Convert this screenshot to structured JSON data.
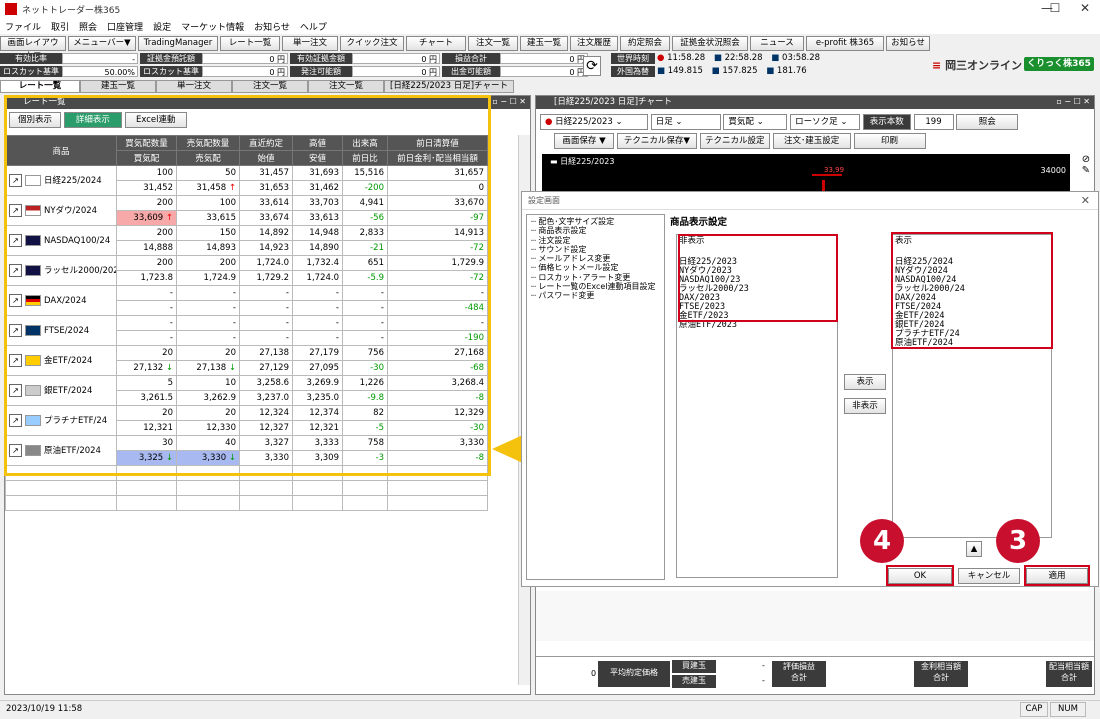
{
  "window": {
    "title": "ネットトレーダー株365",
    "min": "—",
    "max": "☐",
    "close": "✕"
  },
  "menu": [
    "ファイル",
    "取引",
    "照会",
    "口座管理",
    "設定",
    "マーケット情報",
    "お知らせ",
    "ヘルプ"
  ],
  "toolbar": [
    "画面レイアウト▼",
    "メニューバー▼",
    "TradingManager",
    "レート一覧",
    "単一注文",
    "クイック注文",
    "チャート",
    "注文一覧",
    "建玉一覧",
    "注文履歴",
    "約定照会",
    "証拠金状況照会",
    "ニュース",
    "e-profit 株365",
    "お知らせ"
  ],
  "info": {
    "row1": [
      {
        "label": "有効比率",
        "value": "-"
      },
      {
        "label": "証拠金預託額",
        "value": "0 円"
      },
      {
        "label": "有効証拠金額",
        "value": "0 円"
      },
      {
        "label": "損益合計",
        "value": "0 円"
      }
    ],
    "row2": [
      {
        "label": "ロスカット基準",
        "value": "50.00%"
      },
      {
        "label": "ロスカット基準額",
        "value": "0 円"
      },
      {
        "label": "発注可能額",
        "value": "0 円"
      },
      {
        "label": "出金可能額",
        "value": "0 円"
      }
    ],
    "world_time_label": "世界時刻",
    "fx_label": "外国為替",
    "times": [
      "11:58.28",
      "22:58.28",
      "03:58.28"
    ],
    "fx": [
      "149.815",
      "157.825",
      "181.76"
    ]
  },
  "brand": {
    "name": "岡三オンライン",
    "badge": "くりっく株365"
  },
  "tabs": [
    "レート一覧",
    "建玉一覧",
    "単一注文",
    "注文一覧",
    "注文一覧",
    "[日経225/2023 日足]チャート"
  ],
  "rate_panel": {
    "title": "レート一覧",
    "buttons": [
      "個別表示",
      "詳細表示",
      "Excel連動"
    ],
    "headers1": [
      "商品",
      "買気配数量",
      "売気配数量",
      "直近約定",
      "高値",
      "出来高",
      "前日清算値"
    ],
    "headers2": [
      "買気配",
      "売気配",
      "始値",
      "安値",
      "前日比",
      "前日金利･配当相当額"
    ],
    "rows": [
      {
        "name": "日経225/2024",
        "flag": "jp",
        "r1": [
          "100",
          "50",
          "31,457",
          "31,693",
          "15,516",
          "31,657"
        ],
        "r2": [
          "31,452",
          "31,458 ↑",
          "31,653",
          "31,462",
          "-200",
          "0"
        ]
      },
      {
        "name": "NYダウ/2024",
        "flag": "us",
        "r1": [
          "200",
          "100",
          "33,614",
          "33,703",
          "4,941",
          "33,670"
        ],
        "r2": [
          "33,609 ↑",
          "33,615",
          "33,674",
          "33,613",
          "-56",
          "-97"
        ]
      },
      {
        "name": "NASDAQ100/24",
        "flag": "us100",
        "r1": [
          "200",
          "150",
          "14,892",
          "14,948",
          "2,833",
          "14,913"
        ],
        "r2": [
          "14,888",
          "14,893",
          "14,923",
          "14,890",
          "-21",
          "-72"
        ]
      },
      {
        "name": "ラッセル2000/2024",
        "flag": "us2000",
        "r1": [
          "200",
          "200",
          "1,724.0",
          "1,732.4",
          "651",
          "1,729.9"
        ],
        "r2": [
          "1,723.8",
          "1,724.9",
          "1,729.2",
          "1,724.0",
          "-5.9",
          "-72"
        ]
      },
      {
        "name": "DAX/2024",
        "flag": "de",
        "r1": [
          "-",
          "-",
          "-",
          "-",
          "-",
          "-"
        ],
        "r2": [
          "-",
          "-",
          "-",
          "-",
          "-",
          "-484"
        ]
      },
      {
        "name": "FTSE/2024",
        "flag": "uk",
        "r1": [
          "-",
          "-",
          "-",
          "-",
          "-",
          "-"
        ],
        "r2": [
          "-",
          "-",
          "-",
          "-",
          "-",
          "-190"
        ]
      },
      {
        "name": "金ETF/2024",
        "flag": "gold",
        "r1": [
          "20",
          "20",
          "27,138",
          "27,179",
          "756",
          "27,168"
        ],
        "r2": [
          "27,132 ↓",
          "27,138 ↓",
          "27,129",
          "27,095",
          "-30",
          "-68"
        ]
      },
      {
        "name": "銀ETF/2024",
        "flag": "silver",
        "r1": [
          "5",
          "10",
          "3,258.6",
          "3,269.9",
          "1,226",
          "3,268.4"
        ],
        "r2": [
          "3,261.5",
          "3,262.9",
          "3,237.0",
          "3,235.0",
          "-9.8",
          "-8"
        ]
      },
      {
        "name": "プラチナETF/24",
        "flag": "pt",
        "r1": [
          "20",
          "20",
          "12,324",
          "12,374",
          "82",
          "12,329"
        ],
        "r2": [
          "12,321",
          "12,330",
          "12,327",
          "12,321",
          "-5",
          "-30"
        ]
      },
      {
        "name": "原油ETF/2024",
        "flag": "oil",
        "r1": [
          "30",
          "40",
          "3,327",
          "3,333",
          "758",
          "3,330"
        ],
        "r2": [
          "3,325 ↓",
          "3,330 ↓",
          "3,330",
          "3,309",
          "-3",
          "-8"
        ]
      }
    ]
  },
  "chart_panel": {
    "title": "[日経225/2023 日足]チャート",
    "symbol": "日経225/2023",
    "period": "日足",
    "side": "買気配",
    "candle": "ローソク足",
    "count_label": "表示本数",
    "count": "199",
    "query": "照会",
    "btns": [
      "画面保存 ▼",
      "テクニカル保存▼",
      "テクニカル設定",
      "注文･建玉設定",
      "印刷"
    ],
    "legend": "日経225/2023",
    "y_label": "34000",
    "annotation": "33,99"
  },
  "dialog": {
    "title": "設定画面",
    "tree": [
      "配色･文字サイズ設定",
      "商品表示設定",
      "注文設定",
      "サウンド設定",
      "メールアドレス変更",
      "価格ヒットメール設定",
      "ロスカット･アラート変更",
      "レート一覧のExcel連動項目設定",
      "パスワード変更"
    ],
    "heading": "商品表示設定",
    "hidden_label": "非表示",
    "shown_label": "表示",
    "hidden_items": [
      "日経225/2023",
      "NYダウ/2023",
      "NASDAQ100/23",
      "ラッセル2000/23",
      "DAX/2023",
      "FTSE/2023",
      "金ETF/2023",
      "原油ETF/2023"
    ],
    "shown_items": [
      "日経225/2024",
      "NYダウ/2024",
      "NASDAQ100/24",
      "ラッセル2000/24",
      "DAX/2024",
      "FTSE/2024",
      "金ETF/2024",
      "銀ETF/2024",
      "プラチナETF/24",
      "原油ETF/2024"
    ],
    "show_btn": "表示",
    "hide_btn": "非表示",
    "ok": "OK",
    "cancel": "キャンセル",
    "apply": "適用"
  },
  "callouts": [
    "4",
    "3"
  ],
  "bottom": {
    "value": "0",
    "avg_price": "平均約定価格",
    "buy": "買建玉",
    "sell": "売建玉",
    "dash": "-",
    "eval": "評価損益\n合計",
    "interest": "金利相当額\n合計",
    "div": "配当相当額\n合計"
  },
  "status": {
    "time": "2023/10/19 11:58",
    "cap": "CAP",
    "num": "NUM"
  }
}
